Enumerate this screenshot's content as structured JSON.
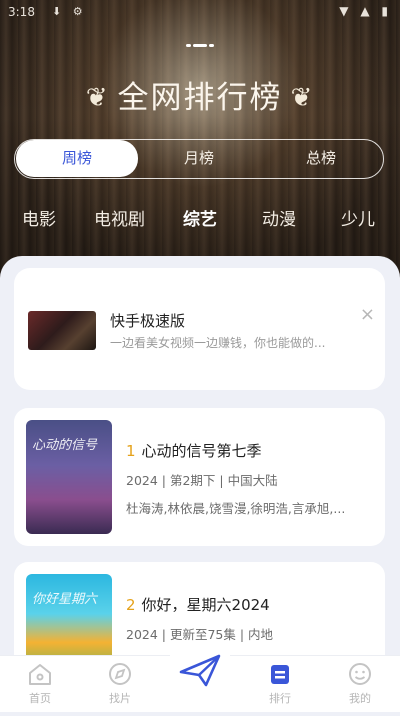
{
  "status": {
    "time": "3:18",
    "left_icons": "⬇ ⚙",
    "right_icons": "▼ ▲ ▮"
  },
  "header": {
    "title": "全网排行榜"
  },
  "period_tabs": [
    {
      "label": "周榜",
      "active": true
    },
    {
      "label": "月榜",
      "active": false
    },
    {
      "label": "总榜",
      "active": false
    }
  ],
  "categories": [
    {
      "label": "电影",
      "active": false
    },
    {
      "label": "电视剧",
      "active": false
    },
    {
      "label": "综艺",
      "active": true
    },
    {
      "label": "动漫",
      "active": false
    },
    {
      "label": "少儿",
      "active": false
    }
  ],
  "ad": {
    "title": "快手极速版",
    "subtitle": "一边看美女视频一边赚钱，你也能做的...",
    "close": "×"
  },
  "items": [
    {
      "rank": "1",
      "title": "心动的信号第七季",
      "meta": "2024 | 第2期下 | 中国大陆",
      "cast": "杜海涛,林依晨,饶雪漫,徐明浩,言承旭,...",
      "poster_text": "心动的信号"
    },
    {
      "rank": "2",
      "title": "你好，星期六2024",
      "meta": "2024 | 更新至75集 | 内地",
      "cast": "",
      "poster_text": "你好星期六"
    }
  ],
  "tabbar": [
    {
      "label": "首页",
      "icon": "home-icon",
      "active": false
    },
    {
      "label": "找片",
      "icon": "compass-icon",
      "active": false
    },
    {
      "label": "",
      "icon": "paper-plane-icon",
      "active": false
    },
    {
      "label": "排行",
      "icon": "ranking-icon",
      "active": true
    },
    {
      "label": "我的",
      "icon": "smile-face-icon",
      "active": false
    }
  ],
  "colors": {
    "accent": "#3a56d8",
    "rank": "#e5a21a"
  }
}
